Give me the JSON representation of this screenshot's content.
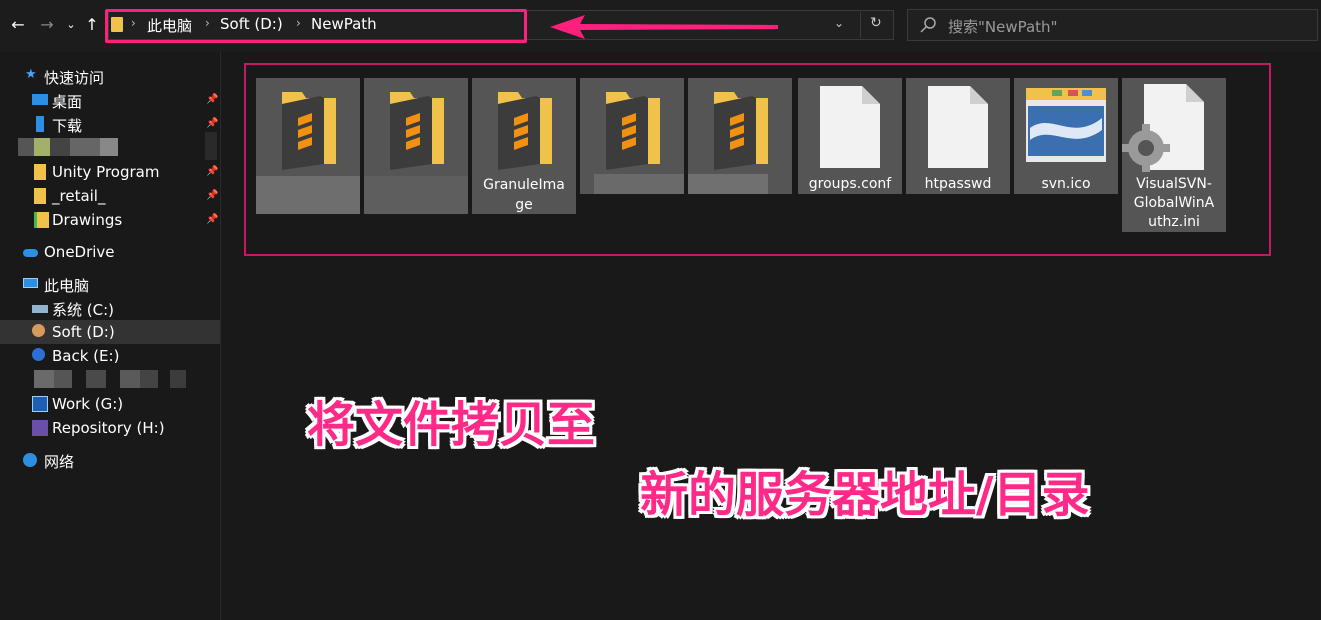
{
  "address": {
    "crumbs": [
      "此电脑",
      "Soft (D:)",
      "NewPath"
    ],
    "dropdown_icon": "chevron-down-icon",
    "refresh_icon": "refresh-icon"
  },
  "search": {
    "placeholder": "搜索\"NewPath\""
  },
  "nav": {
    "back_icon": "back-arrow-icon",
    "forward_icon": "forward-arrow-icon",
    "recent_icon": "chevron-down-icon",
    "up_icon": "up-arrow-icon"
  },
  "sidebar": {
    "quick_access": "快速访问",
    "items": [
      {
        "label": "桌面",
        "pinned": true
      },
      {
        "label": "下载",
        "pinned": true
      },
      {
        "label": "Unity Program",
        "pinned": true
      },
      {
        "label": "_retail_",
        "pinned": true
      },
      {
        "label": "Drawings",
        "pinned": true
      }
    ],
    "onedrive": "OneDrive",
    "this_pc": "此电脑",
    "drives": [
      {
        "label": "系统 (C:)"
      },
      {
        "label": "Soft (D:)",
        "selected": true
      },
      {
        "label": "Back (E:)"
      },
      {
        "label": "Work (G:)"
      },
      {
        "label": "Repository (H:)"
      }
    ],
    "network": "网络"
  },
  "files": [
    {
      "name": "",
      "type": "folder"
    },
    {
      "name": "",
      "type": "folder"
    },
    {
      "name": "GranuleImage",
      "lines": [
        "GranuleIma",
        "ge"
      ],
      "type": "folder"
    },
    {
      "name": "",
      "type": "folder"
    },
    {
      "name": "",
      "type": "folder"
    },
    {
      "name": "groups.conf",
      "lines": [
        "groups.conf"
      ],
      "type": "file"
    },
    {
      "name": "htpasswd",
      "lines": [
        "htpasswd"
      ],
      "type": "file"
    },
    {
      "name": "svn.ico",
      "lines": [
        "svn.ico"
      ],
      "type": "image"
    },
    {
      "name": "VisualSVN-GlobalWinAuthz.ini",
      "lines": [
        "VisualSVN-",
        "GlobalWinA",
        "uthz.ini"
      ],
      "type": "settings"
    }
  ],
  "annotations": {
    "line1": "将文件拷贝至",
    "line2": "新的服务器地址/目录"
  },
  "colors": {
    "highlight": "#ff1f7d",
    "folder": "#f0c14b",
    "accent_orange": "#f29111"
  }
}
